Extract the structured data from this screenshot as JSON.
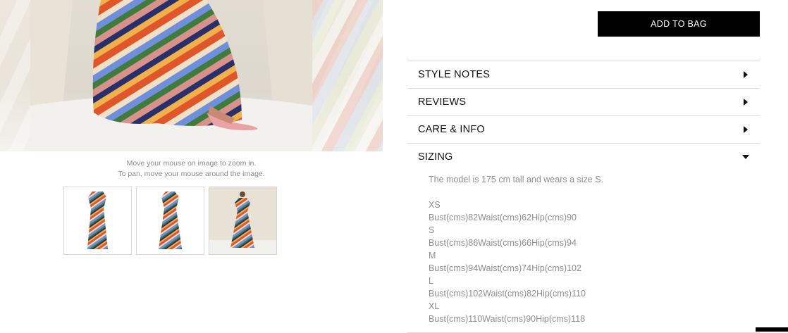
{
  "gallery": {
    "zoom_hint_line1": "Move your mouse on image to zoom in.",
    "zoom_hint_line2": "To pan, move your mouse around the image.",
    "thumbnails": [
      "dress-front",
      "dress-back",
      "dress-model"
    ]
  },
  "product": {
    "add_to_bag_label": "ADD TO BAG"
  },
  "accordion": {
    "style_notes": "STYLE NOTES",
    "reviews": "REVIEWS",
    "care_info": "CARE & INFO",
    "sizing": "SIZING",
    "sizing_intro": "The model is  175 cm tall and wears a size S.",
    "sizes": [
      {
        "size": "XS",
        "measurements": "Bust(cms)82Waist(cms)62Hip(cms)90"
      },
      {
        "size": "S",
        "measurements": "Bust(cms)86Waist(cms)66Hip(cms)94"
      },
      {
        "size": "M",
        "measurements": "Bust(cms)94Waist(cms)74Hip(cms)102"
      },
      {
        "size": "L",
        "measurements": "Bust(cms)102Waist(cms)82Hip(cms)110"
      },
      {
        "size": "XL",
        "measurements": "Bust(cms)110Waist(cms)90Hip(cms)118"
      }
    ]
  },
  "colors": {
    "stripe_orange": "#e0562a",
    "stripe_blue": "#6f8fdc",
    "stripe_green": "#3f7b3a",
    "stripe_cream": "#efe0c6",
    "stripe_rose": "#d9928a",
    "stripe_navy": "#27306b"
  }
}
